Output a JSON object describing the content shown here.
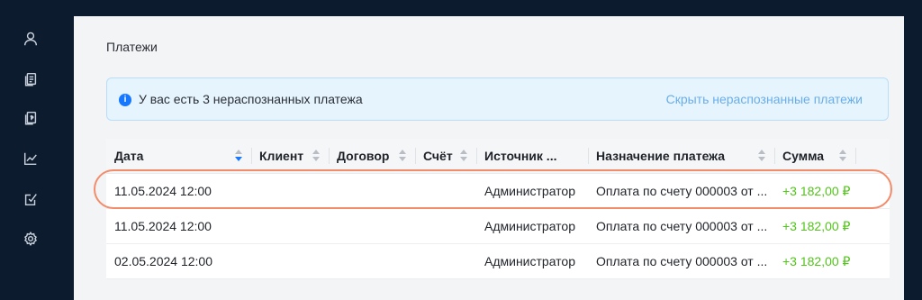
{
  "sidebar": {
    "items": [
      {
        "icon": "user-icon"
      },
      {
        "icon": "documents-icon"
      },
      {
        "icon": "invoice-icon"
      },
      {
        "icon": "chart-icon"
      },
      {
        "icon": "checklist-icon"
      },
      {
        "icon": "settings-icon"
      }
    ]
  },
  "page": {
    "title": "Платежи"
  },
  "banner": {
    "message": "У вас есть 3 нераспознанных платежа",
    "link": "Скрыть нераспознанные платежи"
  },
  "table": {
    "columns": [
      "Дата",
      "Клиент",
      "Договор",
      "Счёт",
      "Источник ...",
      "Назначение платежа",
      "Сумма"
    ],
    "rows": [
      {
        "date": "11.05.2024 12:00",
        "client": "",
        "contract": "",
        "invoice": "",
        "source": "Администратор",
        "purpose": "Оплата по счету 000003 от ...",
        "amount": "+3 182,00 ₽"
      },
      {
        "date": "11.05.2024 12:00",
        "client": "",
        "contract": "",
        "invoice": "",
        "source": "Администратор",
        "purpose": "Оплата по счету 000003 от ...",
        "amount": "+3 182,00 ₽"
      },
      {
        "date": "02.05.2024 12:00",
        "client": "",
        "contract": "",
        "invoice": "",
        "source": "Администратор",
        "purpose": "Оплата по счету 000003 от ...",
        "amount": "+3 182,00 ₽"
      }
    ]
  },
  "colors": {
    "sidebar_bg": "#0d1b2e",
    "accent": "#1677ff",
    "amount": "#52c41a",
    "highlight_ring": "#f28c6a"
  }
}
